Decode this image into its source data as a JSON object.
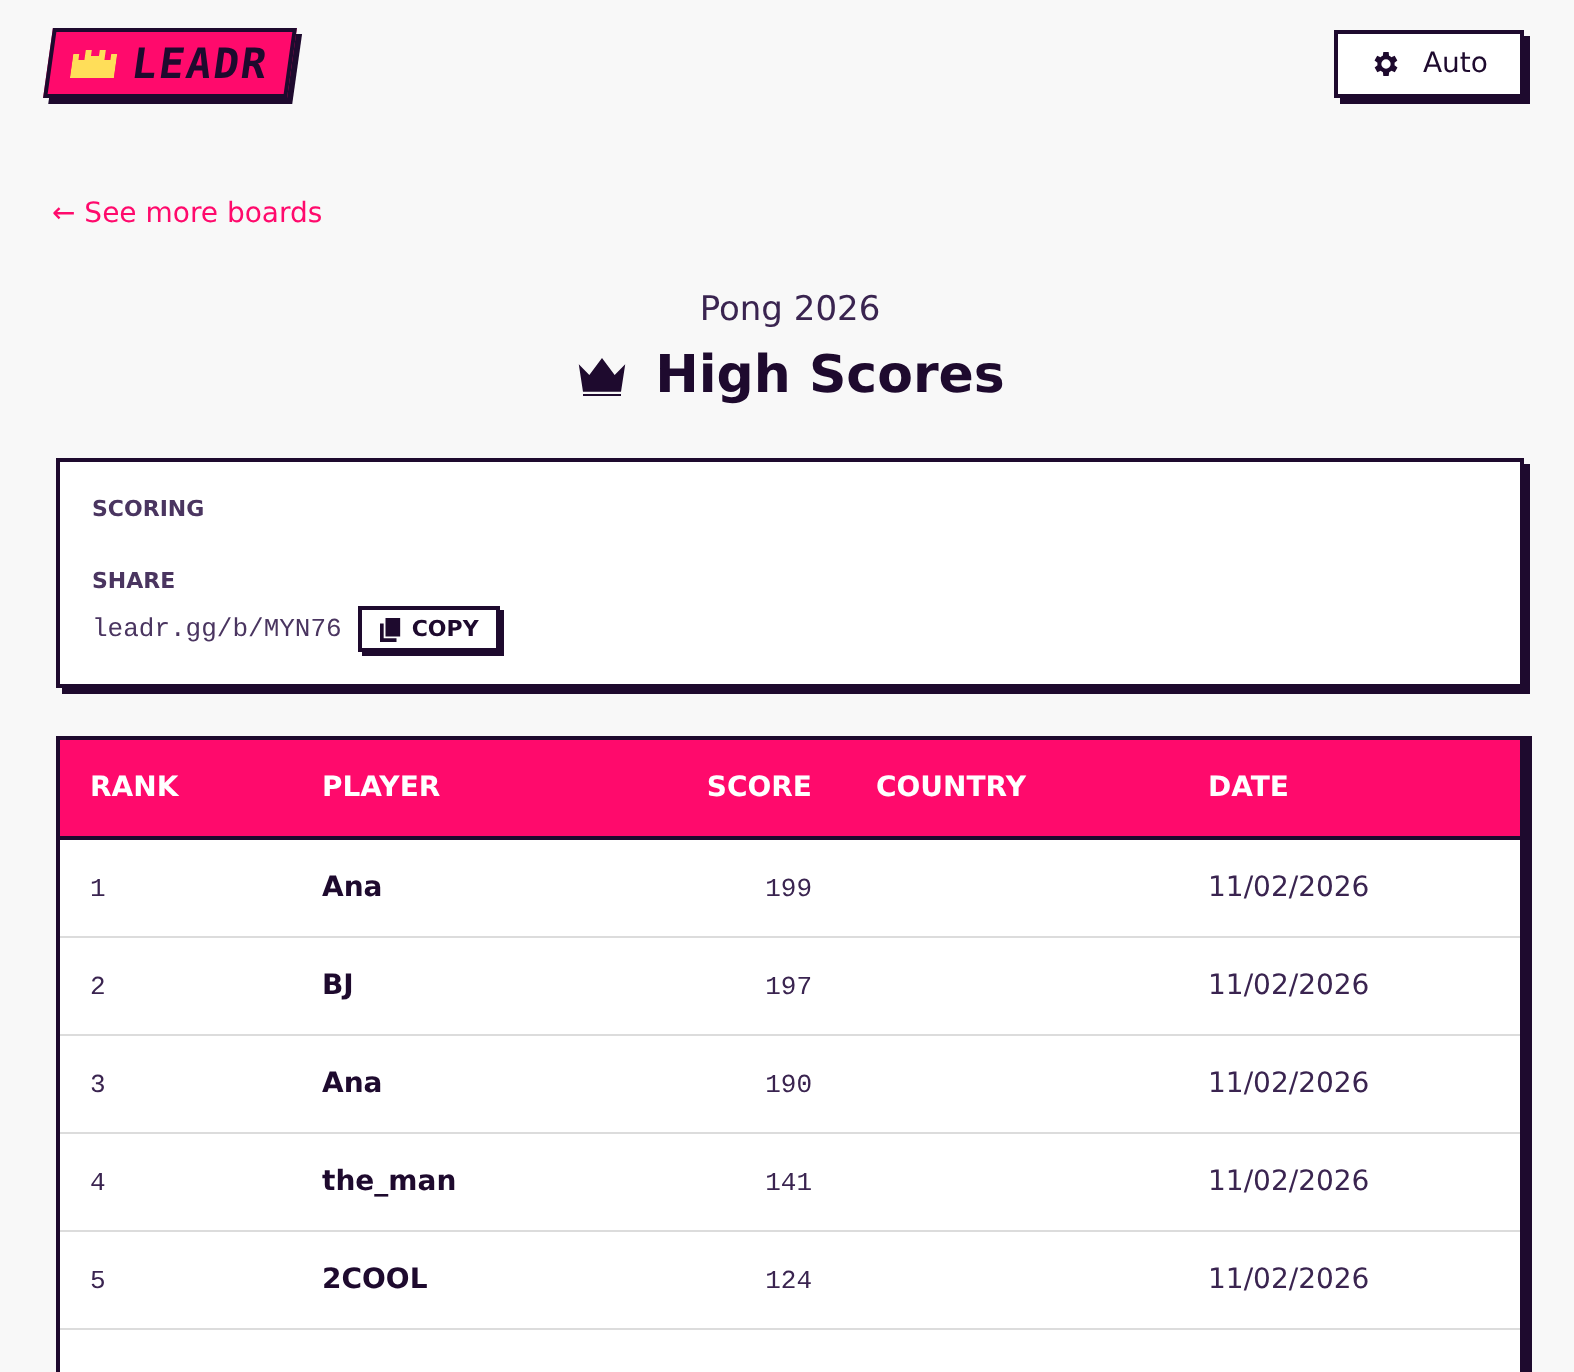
{
  "logo": {
    "text": "LEADR"
  },
  "theme_button": {
    "label": "Auto"
  },
  "back_link": {
    "arrow": "←",
    "label": "See more boards"
  },
  "board": {
    "game": "Pong 2026",
    "title": "High Scores"
  },
  "info": {
    "scoring_label": "SCORING",
    "share_label": "SHARE",
    "share_url": "leadr.gg/b/MYN76",
    "copy_label": "COPY"
  },
  "table": {
    "columns": [
      "RANK",
      "PLAYER",
      "SCORE",
      "COUNTRY",
      "DATE"
    ],
    "rows": [
      {
        "rank": "1",
        "player": "Ana",
        "score": "199",
        "date": "11/02/2026"
      },
      {
        "rank": "2",
        "player": "BJ",
        "score": "197",
        "date": "11/02/2026"
      },
      {
        "rank": "3",
        "player": "Ana",
        "score": "190",
        "date": "11/02/2026"
      },
      {
        "rank": "4",
        "player": "the_man",
        "score": "141",
        "date": "11/02/2026"
      },
      {
        "rank": "5",
        "player": "2COOL",
        "score": "124",
        "date": "11/02/2026"
      }
    ]
  }
}
